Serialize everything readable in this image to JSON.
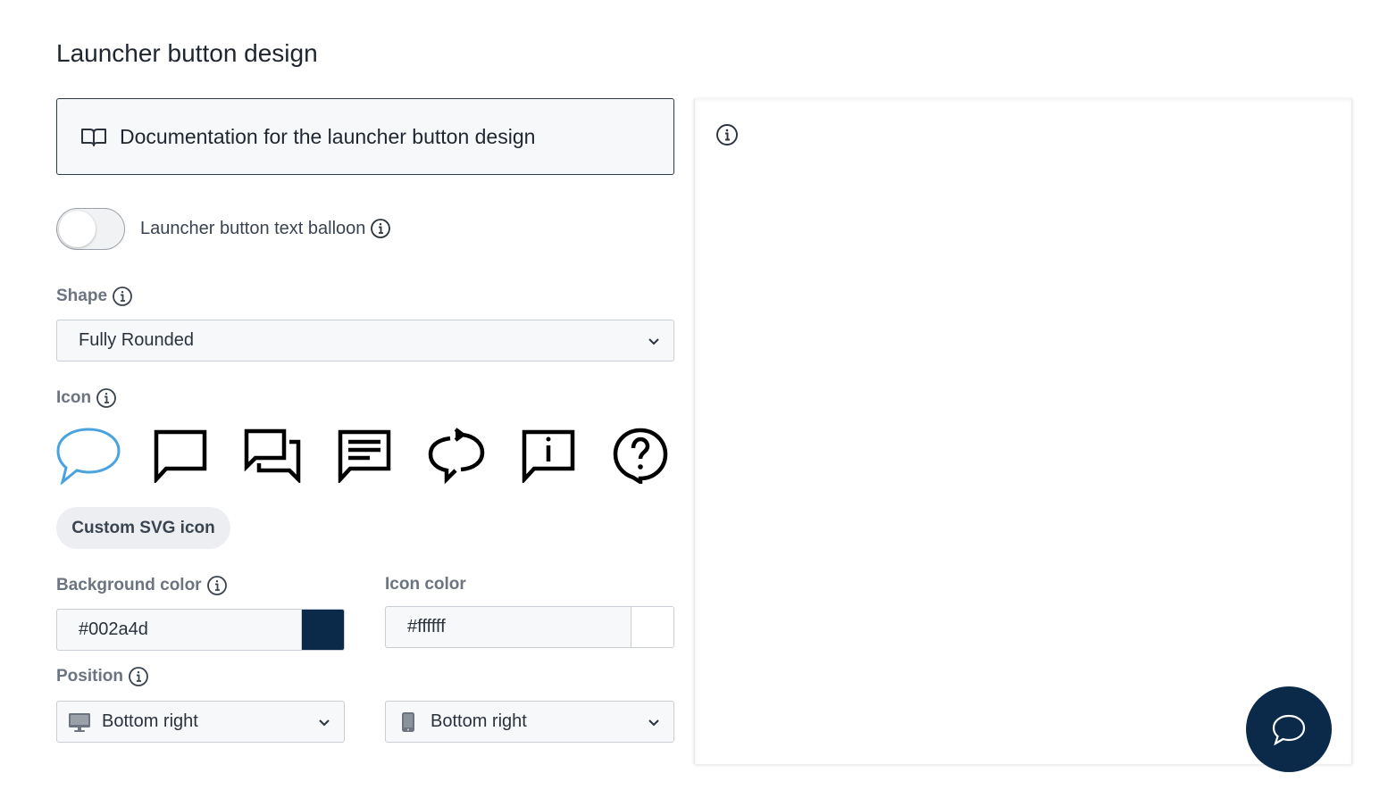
{
  "page": {
    "title": "Launcher button design"
  },
  "doc_link": {
    "label": "Documentation for the launcher button design",
    "icon": "book-icon"
  },
  "balloon_toggle": {
    "label": "Launcher button text balloon",
    "enabled": false
  },
  "shape": {
    "label": "Shape",
    "value": "Fully Rounded"
  },
  "icon_picker": {
    "label": "Icon",
    "options": [
      "chat-bubble-oval-icon",
      "chat-square-icon",
      "chat-double-icon",
      "chat-text-icon",
      "chat-refresh-icon",
      "chat-info-icon",
      "chat-question-icon"
    ],
    "selected": "chat-bubble-oval-icon",
    "selected_color": "#4aa3df"
  },
  "custom_svg": {
    "label": "Custom SVG icon"
  },
  "background_color": {
    "label": "Background color",
    "value": "#002a4d",
    "swatch": "#0b2a4a"
  },
  "icon_color": {
    "label": "Icon color",
    "value": "#ffffff",
    "swatch": "#ffffff"
  },
  "position": {
    "label": "Position",
    "desktop": {
      "value": "Bottom right",
      "icon": "desktop-icon"
    },
    "mobile": {
      "value": "Bottom right",
      "icon": "mobile-icon"
    }
  },
  "preview": {
    "launcher_bg": "#0b2a4a",
    "launcher_icon": "chat-bubble-oval-icon",
    "launcher_icon_color": "#ffffff"
  }
}
